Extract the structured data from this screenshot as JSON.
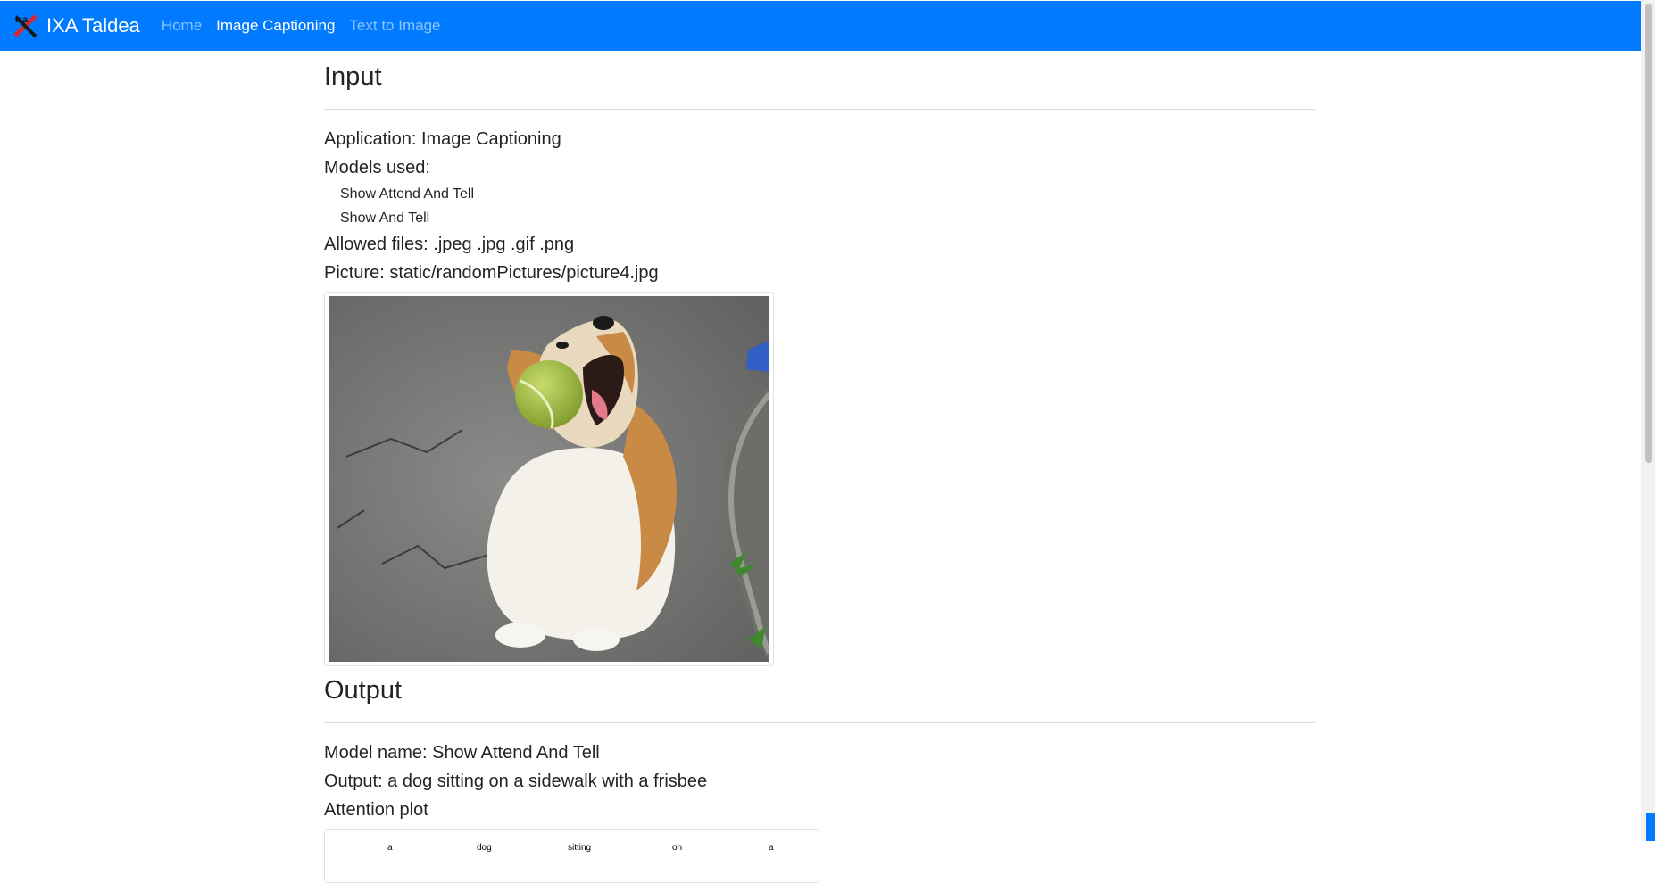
{
  "navbar": {
    "brand": "IXA Taldea",
    "logo_text": "ixa",
    "links": [
      {
        "label": "Home",
        "active": false
      },
      {
        "label": "Image Captioning",
        "active": true
      },
      {
        "label": "Text to Image",
        "active": false
      }
    ],
    "color": "#007bff"
  },
  "input": {
    "heading": "Input",
    "application": "Application: Image Captioning",
    "models_heading": "Models used:",
    "models": [
      "Show Attend And Tell",
      "Show And Tell"
    ],
    "allowed_files": "Allowed files: .jpeg .jpg .gif .png",
    "picture": "Picture: static/randomPictures/picture4.jpg"
  },
  "output": {
    "heading": "Output",
    "model_name": "Model name: Show Attend And Tell",
    "output_text": "Output: a dog sitting on a sidewalk with a frisbee",
    "plot_heading": "Attention plot",
    "plot_words": [
      "a",
      "dog",
      "sitting",
      "on",
      "a"
    ]
  }
}
